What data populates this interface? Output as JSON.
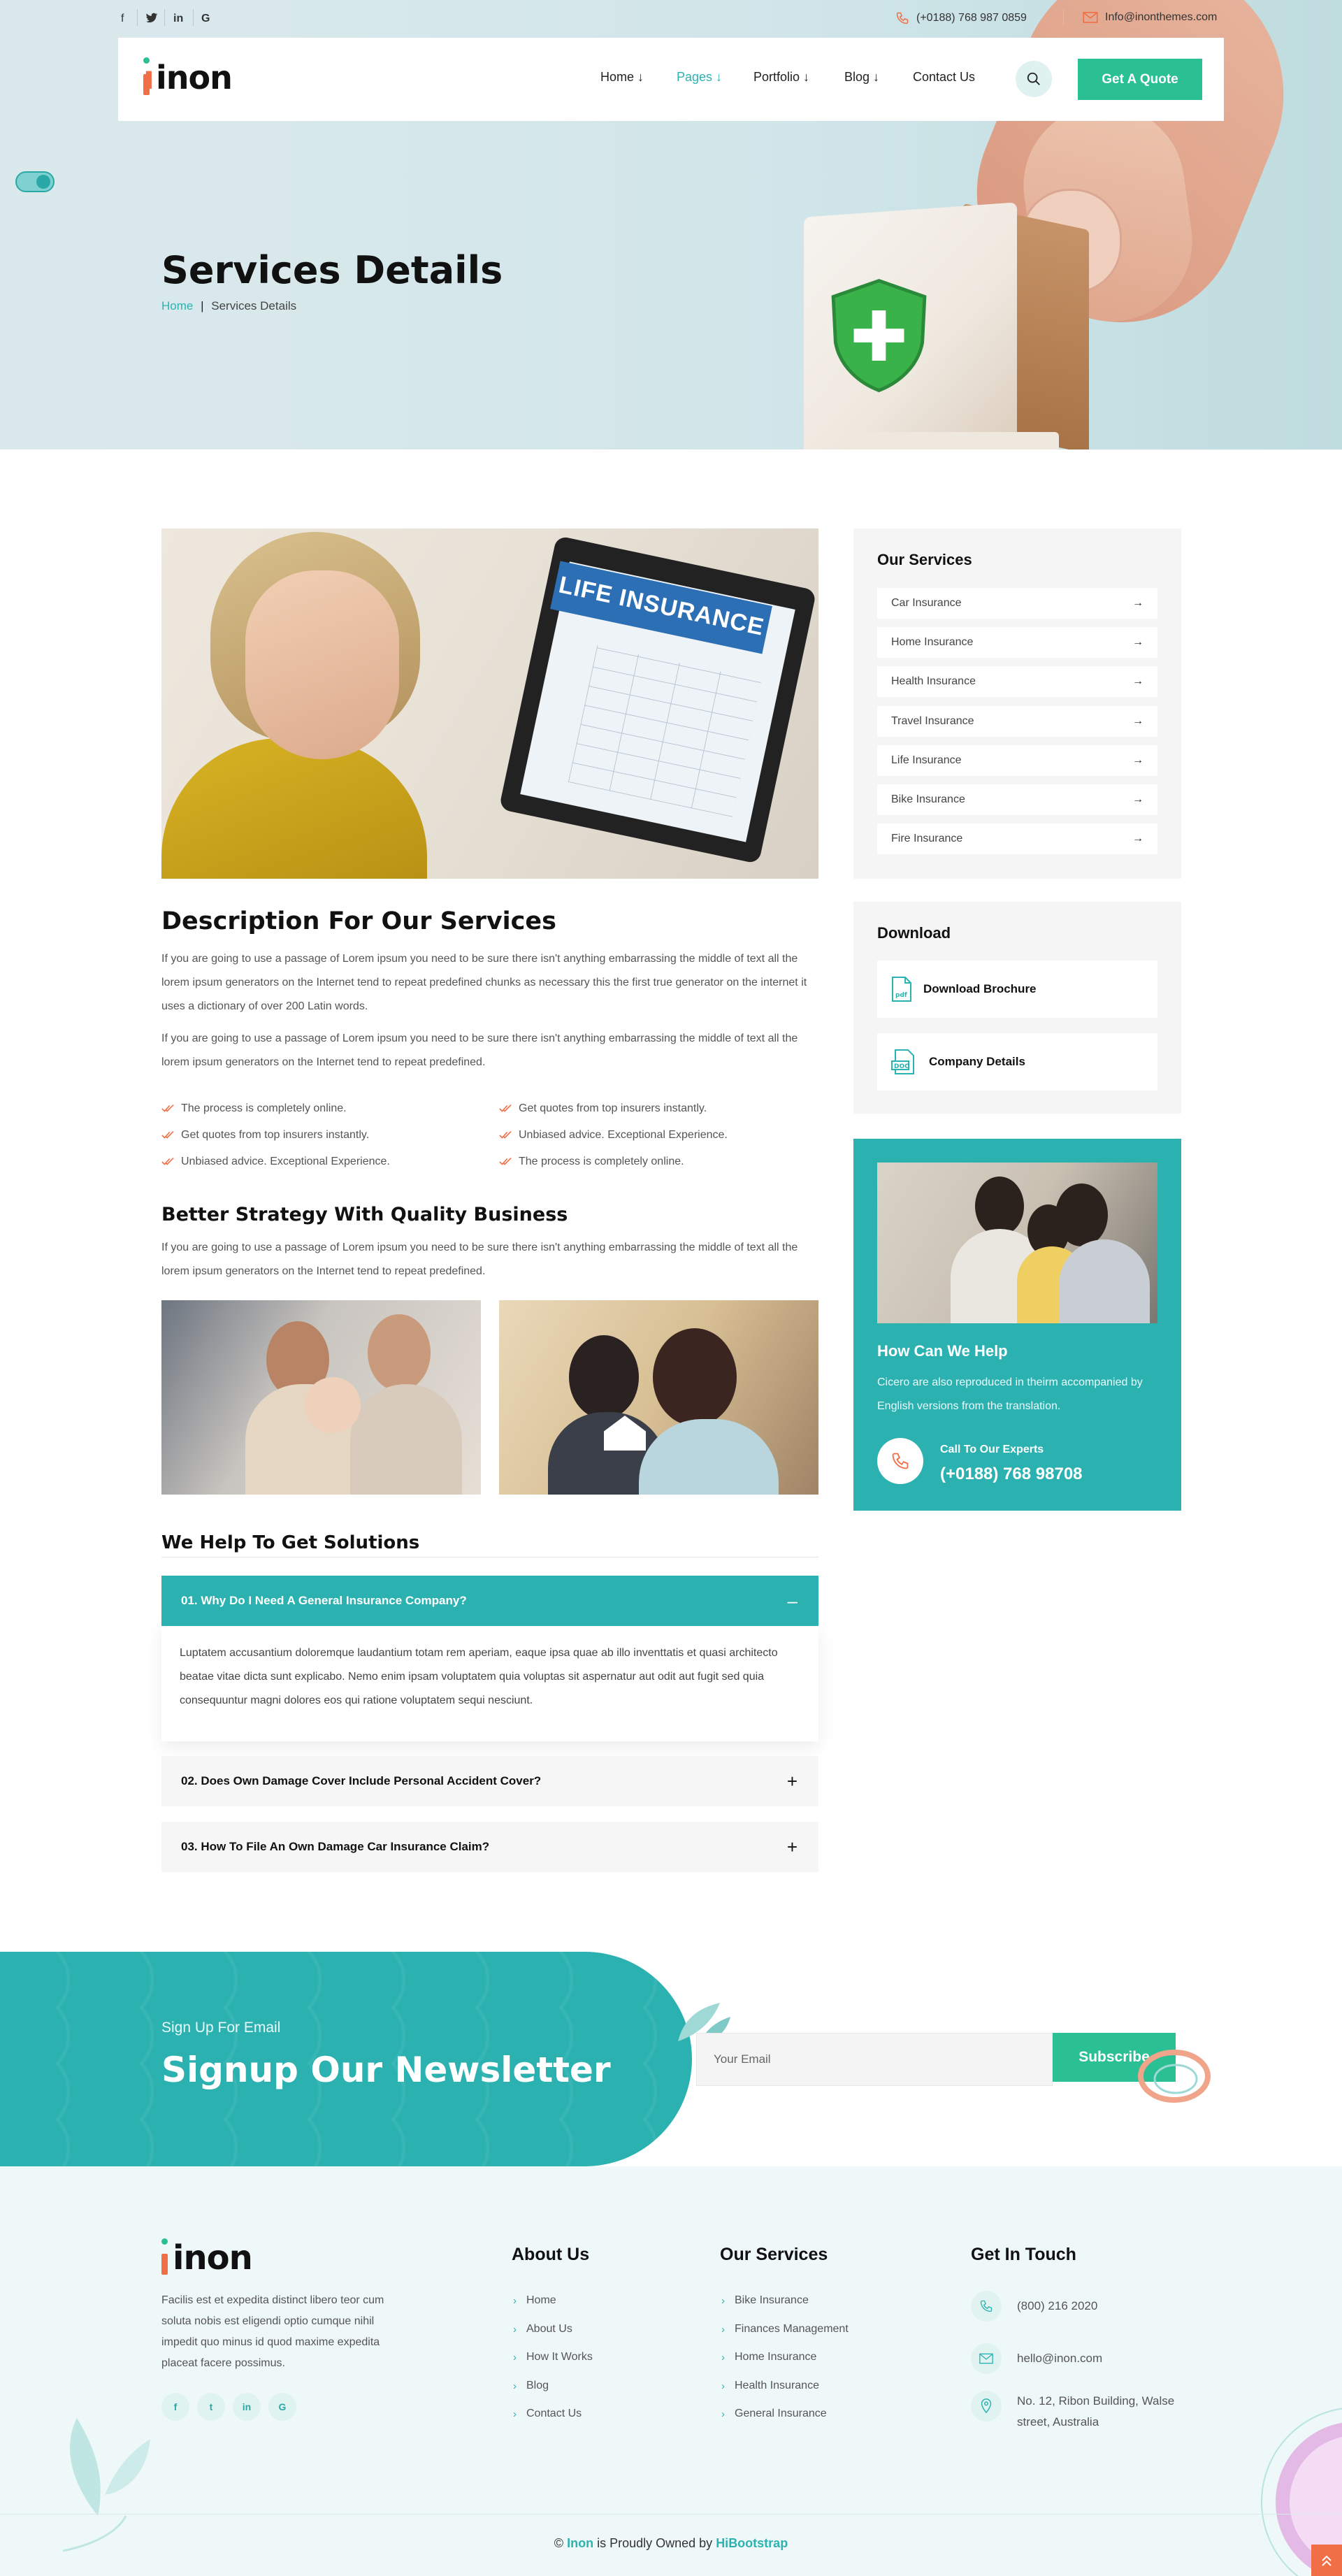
{
  "topbar": {
    "social": [
      "f",
      "t",
      "in",
      "G"
    ],
    "phone": "(+0188) 768 987 0859",
    "email": "Info@inonthemes.com"
  },
  "nav": {
    "logo": "inon",
    "menu": [
      "Home",
      "Pages",
      "Portfolio",
      "Blog",
      "Contact Us"
    ],
    "active": "Pages",
    "quote_label": "Get A Quote"
  },
  "hero": {
    "title": "Services Details",
    "crumb_home": "Home",
    "crumb_sep": "|",
    "crumb_current": "Services Details"
  },
  "image_main": {
    "screen_title": "LIFE INSURANCE"
  },
  "description": {
    "title": "Description For Our Services",
    "p1": "If you are going to use a passage of Lorem ipsum you need to be sure there isn't anything embarrassing the middle of text all the lorem ipsum generators on the Internet tend to repeat predefined chunks as necessary this the first true generator on the internet it uses a dictionary of over 200 Latin words.",
    "p2": "If you are going to use a passage of Lorem ipsum you need to be sure there isn't anything embarrassing the middle of text all the lorem ipsum generators on the Internet tend to repeat predefined.",
    "checks_left": [
      "The process is completely online.",
      "Get quotes from top insurers instantly.",
      "Unbiased advice. Exceptional Experience."
    ],
    "checks_right": [
      "Get quotes from top insurers instantly.",
      "Unbiased advice. Exceptional Experience.",
      "The process is completely online."
    ]
  },
  "strategy": {
    "title": "Better Strategy With Quality Business",
    "p": "If you are going to use a passage of Lorem ipsum you need to be sure there isn't anything embarrassing the middle of text all the lorem ipsum generators on the Internet tend to repeat predefined."
  },
  "faq": {
    "title": "We Help To Get Solutions",
    "items": [
      {
        "q": "01. Why Do I Need A General Insurance Company?",
        "a": "Luptatem accusantium doloremque laudantium totam rem aperiam, eaque ipsa quae ab illo inventtatis et quasi architecto beatae vitae dicta sunt explicabo. Nemo enim ipsam voluptatem quia voluptas sit aspernatur aut odit aut fugit sed quia consequuntur magni dolores eos qui ratione voluptatem sequi nesciunt.",
        "sign": "–"
      },
      {
        "q": "02. Does Own Damage Cover Include Personal Accident Cover?",
        "sign": "+"
      },
      {
        "q": "03. How To File An Own Damage Car Insurance Claim?",
        "sign": "+"
      }
    ]
  },
  "sidebar": {
    "services_title": "Our Services",
    "services": [
      "Car Insurance",
      "Home Insurance",
      "Health Insurance",
      "Travel Insurance",
      "Life Insurance",
      "Bike Insurance",
      "Fire Insurance"
    ],
    "download_title": "Download",
    "downloads": [
      "Download Brochure",
      "Company Details"
    ],
    "help_title": "How Can We Help",
    "help_desc": "Cicero are also reproduced in theirm accompanied by English versions from the translation.",
    "call_label": "Call To Our Experts",
    "call_number": "(+0188) 768 98708"
  },
  "newsletter": {
    "sub": "Sign Up For Email",
    "title": "Signup Our Newsletter",
    "placeholder": "Your Email",
    "button": "Subscribe"
  },
  "footer": {
    "logo": "inon",
    "desc": "Facilis est et expedita distinct libero teor cum soluta nobis est eligendi optio cumque nihil impedit quo minus id quod maxime expedita placeat facere possimus.",
    "social": [
      "f",
      "t",
      "in",
      "G"
    ],
    "about_title": "About Us",
    "about_links": [
      "Home",
      "About Us",
      "How It Works",
      "Blog",
      "Contact Us"
    ],
    "services_title": "Our Services",
    "services_links": [
      "Bike Insurance",
      "Finances Management",
      "Home Insurance",
      "Health Insurance",
      "General Insurance"
    ],
    "contact_title": "Get In Touch",
    "contact_phone": "(800) 216 2020",
    "contact_email": "hello@inon.com",
    "contact_address": "No. 12, Ribon Building, Walse street, Australia",
    "copy_prefix": "©",
    "copy_brand": "Inon",
    "copy_mid": "is Proudly Owned by",
    "copy_owner": "HiBootstrap"
  },
  "colors": {
    "teal": "#2cb1b1",
    "green": "#2bbf94",
    "orange": "#f06f46"
  }
}
